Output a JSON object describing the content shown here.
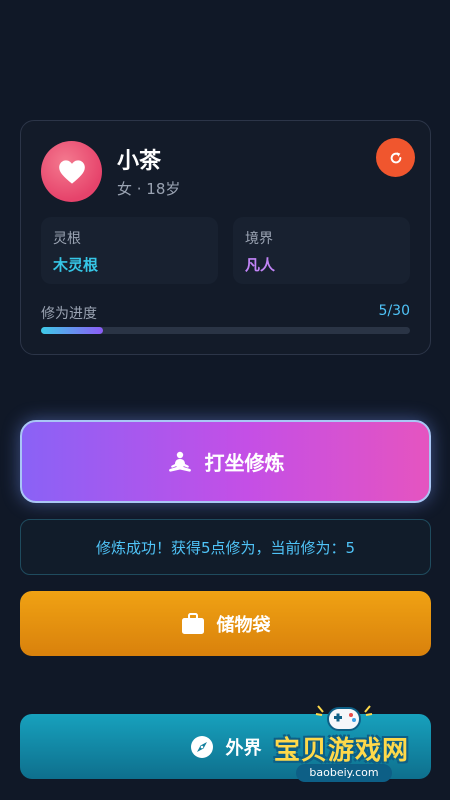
{
  "profile": {
    "name": "小茶",
    "info": "女 · 18岁",
    "avatar_icon": "heart-icon",
    "refresh_icon": "refresh-icon"
  },
  "stats": {
    "root": {
      "label": "灵根",
      "value": "木灵根",
      "color": "#36c6e6"
    },
    "realm": {
      "label": "境界",
      "value": "凡人",
      "color": "#c184f6"
    }
  },
  "progress": {
    "label": "修为进度",
    "count": "5/30",
    "current": 5,
    "max": 30
  },
  "actions": {
    "meditate_label": "打坐修炼",
    "meditate_icon": "meditation-icon",
    "message": "修炼成功！获得5点修为，当前修为：5",
    "bag_label": "储物袋",
    "bag_icon": "briefcase-icon",
    "world_label": "外界",
    "world_icon": "compass-icon"
  },
  "watermark": {
    "title": "宝贝游戏网",
    "url": "baobeiy.com"
  },
  "colors": {
    "background": "#101827",
    "accent_cyan": "#4fc3f7",
    "accent_purple": "#8a62f6",
    "accent_orange": "#f0a213",
    "accent_teal": "#17a1bd",
    "refresh": "#f0562e"
  }
}
